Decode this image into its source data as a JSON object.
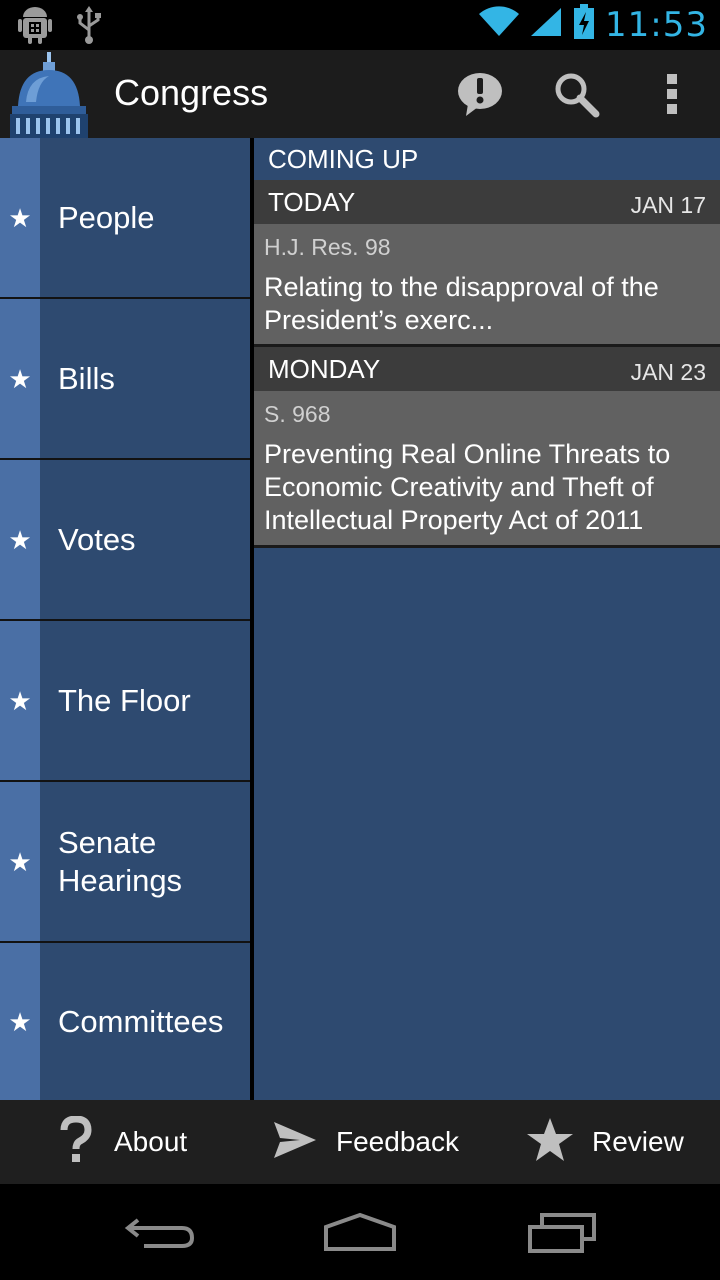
{
  "status_bar": {
    "time": "11:53",
    "icons": [
      "android-debug-icon",
      "usb-icon",
      "wifi-icon",
      "cell-signal-icon",
      "battery-charging-icon"
    ],
    "accent_color": "#33b5e5"
  },
  "action_bar": {
    "title": "Congress",
    "logo": "capitol-dome-icon",
    "actions": [
      {
        "name": "alert-icon"
      },
      {
        "name": "search-icon"
      },
      {
        "name": "overflow-menu-icon"
      }
    ]
  },
  "sidebar": {
    "items": [
      {
        "label": "People",
        "icon": "star-icon"
      },
      {
        "label": "Bills",
        "icon": "star-icon"
      },
      {
        "label": "Votes",
        "icon": "star-icon"
      },
      {
        "label": "The Floor",
        "icon": "star-icon"
      },
      {
        "label": "Senate Hearings",
        "icon": "star-icon"
      },
      {
        "label": "Committees",
        "icon": "star-icon"
      }
    ]
  },
  "coming_up": {
    "header": "COMING UP",
    "days": [
      {
        "day": "TODAY",
        "date": "JAN 17",
        "bill_code": "H.J. Res. 98",
        "bill_title": "Relating to the disapproval of the President’s exerc..."
      },
      {
        "day": "MONDAY",
        "date": "JAN 23",
        "bill_code": "S. 968",
        "bill_title": "Preventing Real Online Threats to Economic Creativity and Theft of Intellectual Property Act of 2011"
      }
    ]
  },
  "toolbar": {
    "about_label": "About",
    "feedback_label": "Feedback",
    "review_label": "Review"
  },
  "colors": {
    "panel_blue": "#2e4a70",
    "star_column": "#4a6fa5",
    "card_gray": "#616161",
    "day_header": "#3c3c3c"
  }
}
